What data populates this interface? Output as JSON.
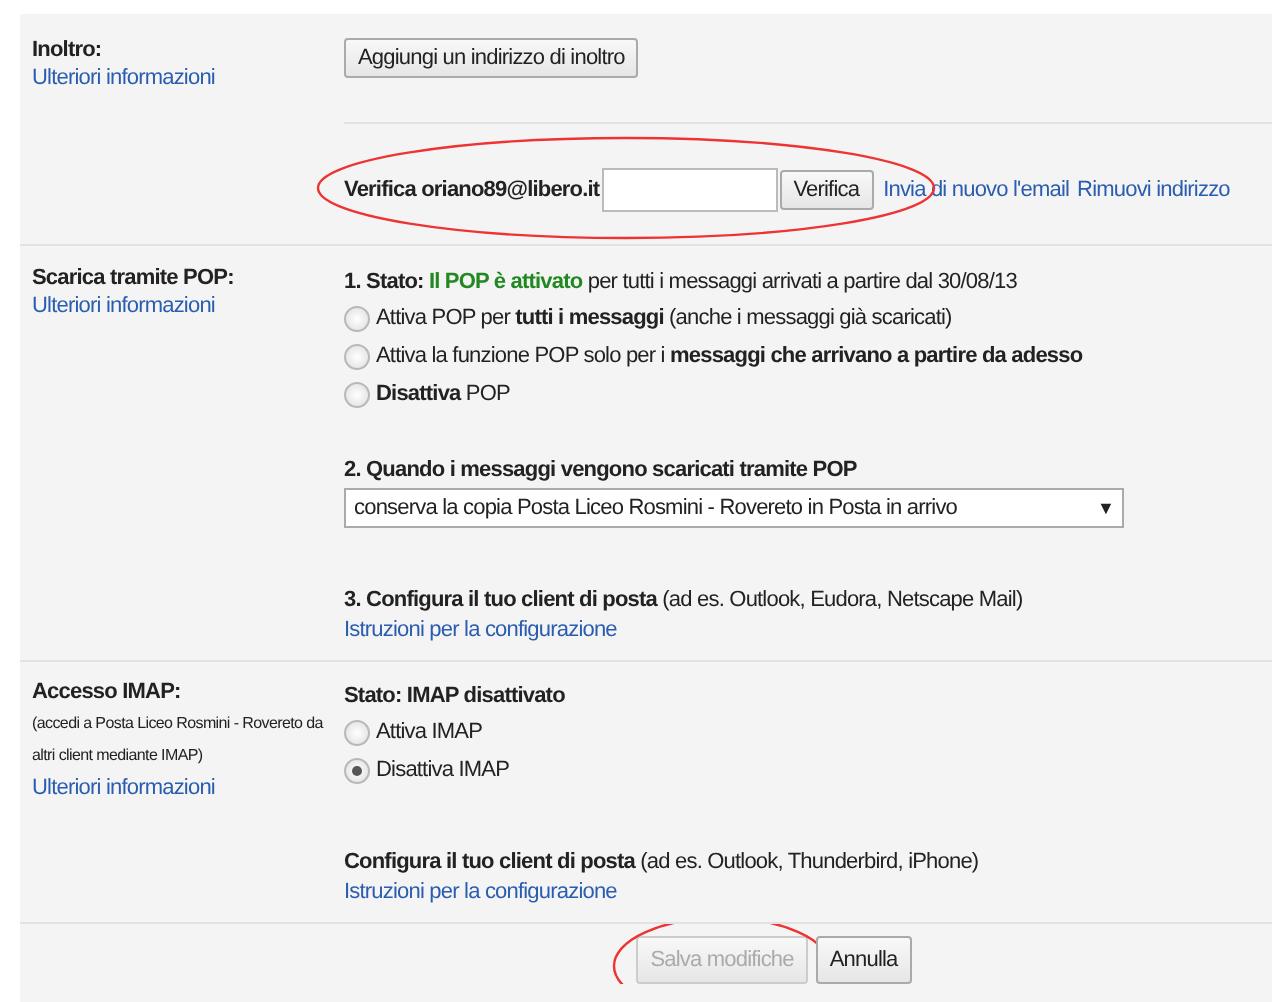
{
  "forwarding": {
    "title": "Inoltro:",
    "link": "Ulteriori informazioni",
    "add_button": "Aggiungi un indirizzo di inoltro",
    "verify": {
      "label": "Verifica oriano89@libero.it",
      "button": "Verifica",
      "links": [
        "Invia di nuovo l'email",
        "Rimuovi indirizzo"
      ],
      "highlighted": true
    }
  },
  "pop": {
    "title": "Scarica tramite POP:",
    "link": "Ulteriori informazioni",
    "status_label": "1. Stato:",
    "status_value": "Il POP è attivato",
    "status_rest": "per tutti i messaggi arrivati a partire dal 30/08/13",
    "options": [
      {
        "label": "Attiva POP per **tutti i messaggi** (anche i messaggi già scaricati)",
        "selected": false
      },
      {
        "label": "Attiva la funzione POP solo per i **messaggi che arrivano a partire da adesso**",
        "selected": false
      },
      {
        "label": "**Disattiva** POP",
        "selected": false
      }
    ],
    "when_heading": "2. Quando i messaggi vengono scaricati tramite POP",
    "when_value": "conserva la copia Posta Liceo Rosmini - Rovereto in Posta in arrivo",
    "dropdown_arrow": "▼",
    "configure": "**3. Configura il tuo client di posta** (ad es. Outlook, Eudora, Netscape Mail)",
    "configure_link": "Istruzioni per la configurazione"
  },
  "imap": {
    "title": "Accesso IMAP:",
    "subtitle": "(accedi a Posta Liceo Rosmini - Rovereto da altri client mediante IMAP)",
    "link": "Ulteriori informazioni",
    "status": "Stato: IMAP disattivato",
    "options": [
      {
        "label": "Attiva IMAP",
        "selected": false
      },
      {
        "label": "Disattiva IMAP",
        "selected": true
      }
    ],
    "configure": "**Configura il tuo client di posta** (ad es. Outlook, Thunderbird, iPhone)",
    "configure_link": "Istruzioni per la configurazione"
  },
  "buttons": [
    {
      "label": "Salva modifiche",
      "disabled": true,
      "highlighted": true
    },
    {
      "label": "Annulla",
      "disabled": false,
      "highlighted": false
    }
  ]
}
